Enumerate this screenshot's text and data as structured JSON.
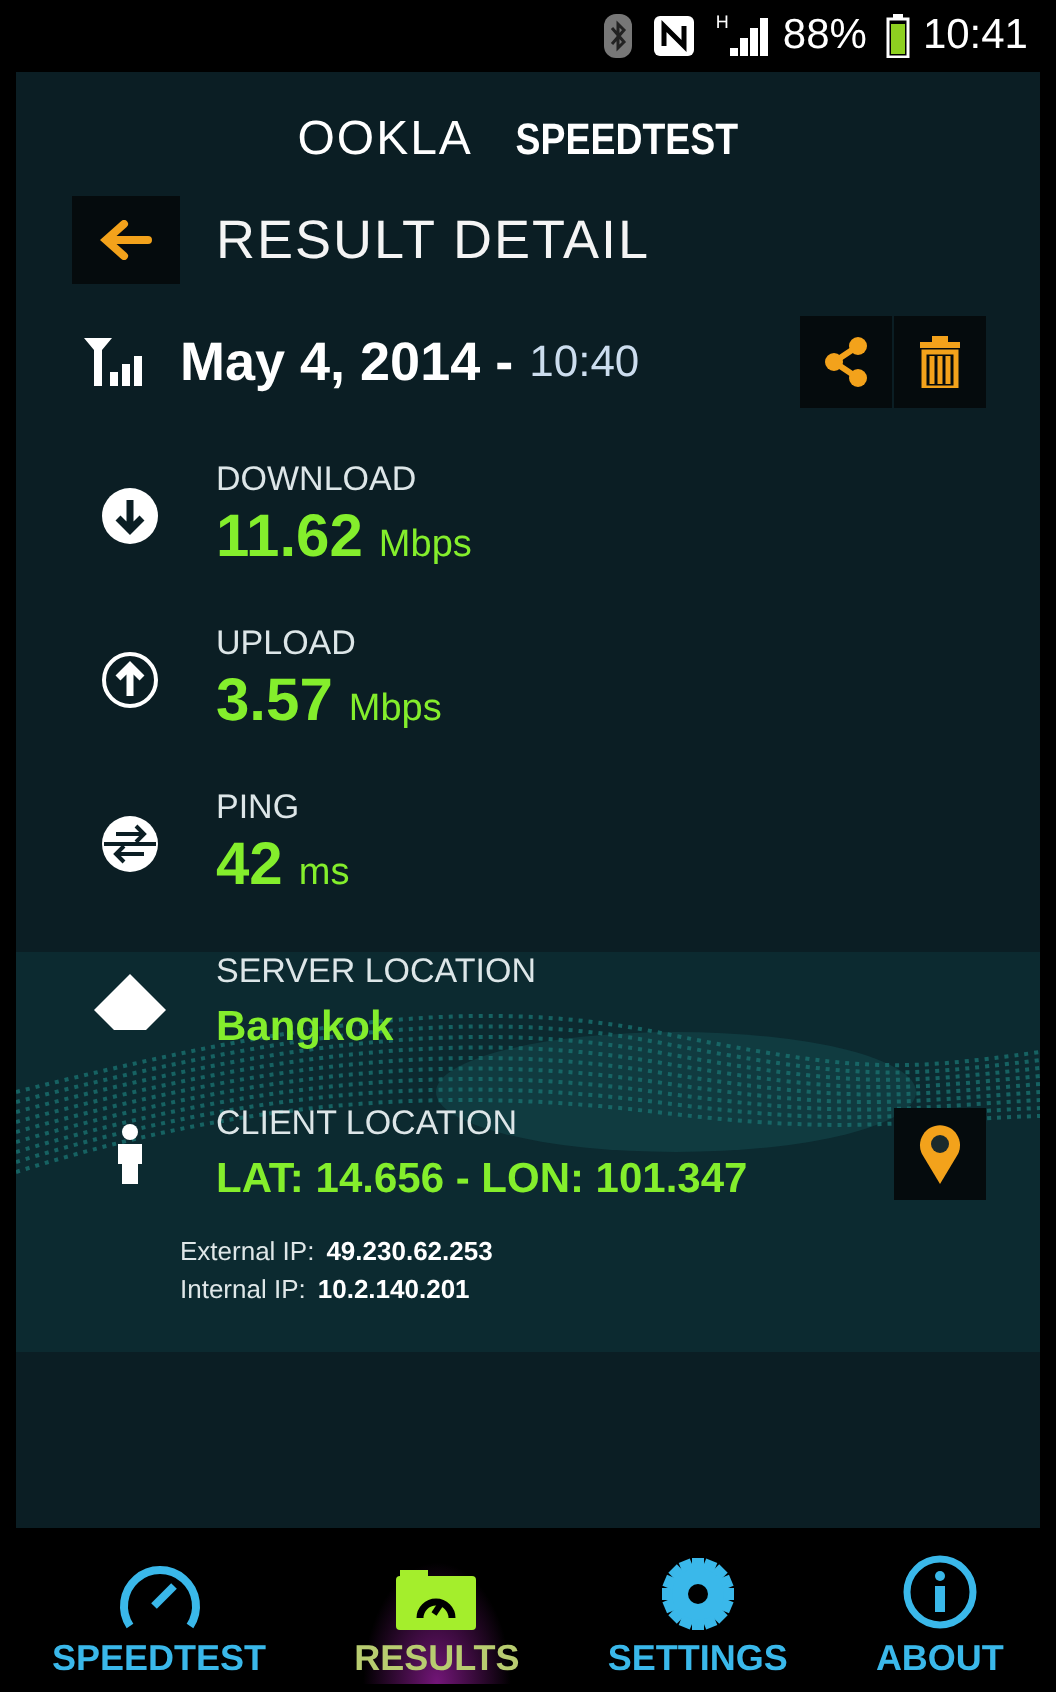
{
  "status_bar": {
    "network": "H",
    "battery": "88%",
    "time": "10:41"
  },
  "logo": {
    "brand": "OOKLA",
    "product": "SPEEDTEST"
  },
  "header": {
    "title": "RESULT DETAIL"
  },
  "result": {
    "date": "May 4, 2014 -",
    "time": "10:40"
  },
  "metrics": [
    {
      "kind": "download",
      "label": "DOWNLOAD",
      "value": "11.62",
      "unit": "Mbps"
    },
    {
      "kind": "upload",
      "label": "UPLOAD",
      "value": "3.57",
      "unit": "Mbps"
    },
    {
      "kind": "ping",
      "label": "PING",
      "value": "42",
      "unit": "ms"
    },
    {
      "kind": "server",
      "label": "SERVER LOCATION",
      "value": "Bangkok"
    },
    {
      "kind": "client",
      "label": "CLIENT LOCATION",
      "value": "LAT: 14.656 - LON: 101.347"
    }
  ],
  "ips": [
    {
      "label": "External IP:",
      "value": "49.230.62.253"
    },
    {
      "label": "Internal IP:",
      "value": "10.2.140.201"
    }
  ],
  "nav": [
    {
      "kind": "speedtest",
      "label": "SPEEDTEST",
      "selected": false
    },
    {
      "kind": "results",
      "label": "RESULTS",
      "selected": true
    },
    {
      "kind": "settings",
      "label": "SETTINGS",
      "selected": false
    },
    {
      "kind": "about",
      "label": "ABOUT",
      "selected": false
    }
  ]
}
